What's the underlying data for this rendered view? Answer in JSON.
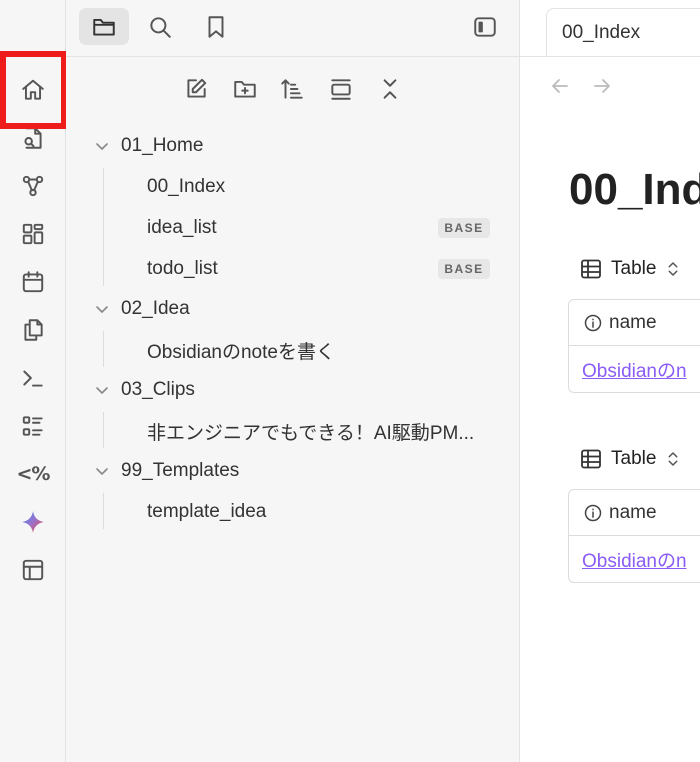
{
  "ribbon": {
    "items": [
      {
        "name": "home-icon"
      },
      {
        "name": "search-file-icon"
      },
      {
        "name": "graph-icon"
      },
      {
        "name": "canvas-icon"
      },
      {
        "name": "calendar-icon"
      },
      {
        "name": "copy-icon"
      },
      {
        "name": "terminal-icon"
      },
      {
        "name": "list-icon"
      },
      {
        "name": "templater-icon",
        "glyph": "<%"
      },
      {
        "name": "sparkle-icon"
      },
      {
        "name": "layout-icon"
      }
    ],
    "highlight_color": "#ef1c1c"
  },
  "sidebar": {
    "tabs": [
      {
        "name": "folder-icon",
        "active": true
      },
      {
        "name": "search-icon",
        "active": false
      },
      {
        "name": "bookmark-icon",
        "active": false
      }
    ],
    "toggle_icon": "sidebar-toggle-icon",
    "toolbar": [
      "new-note-icon",
      "new-folder-icon",
      "sort-icon",
      "collapse-view-icon",
      "collapse-all-icon"
    ],
    "tree": [
      {
        "label": "01_Home",
        "type": "folder"
      },
      {
        "label": "00_Index",
        "type": "file"
      },
      {
        "label": "idea_list",
        "type": "file",
        "badge": "BASE"
      },
      {
        "label": "todo_list",
        "type": "file",
        "badge": "BASE"
      },
      {
        "label": "02_Idea",
        "type": "folder"
      },
      {
        "label": "Obsidianのnoteを書く",
        "type": "file"
      },
      {
        "label": "03_Clips",
        "type": "folder"
      },
      {
        "label": "非エンジニアでもできる！AI駆動PM...",
        "type": "file"
      },
      {
        "label": "99_Templates",
        "type": "folder"
      },
      {
        "label": "template_idea",
        "type": "file"
      }
    ]
  },
  "main": {
    "tab_title": "00_Index",
    "page_title": "00_Ind",
    "views": [
      {
        "label": "Table",
        "header": "name",
        "cell": "Obsidianのn"
      },
      {
        "label": "Table",
        "header": "name",
        "cell": "Obsidianのn"
      }
    ],
    "link_color": "#8a5cf5"
  }
}
